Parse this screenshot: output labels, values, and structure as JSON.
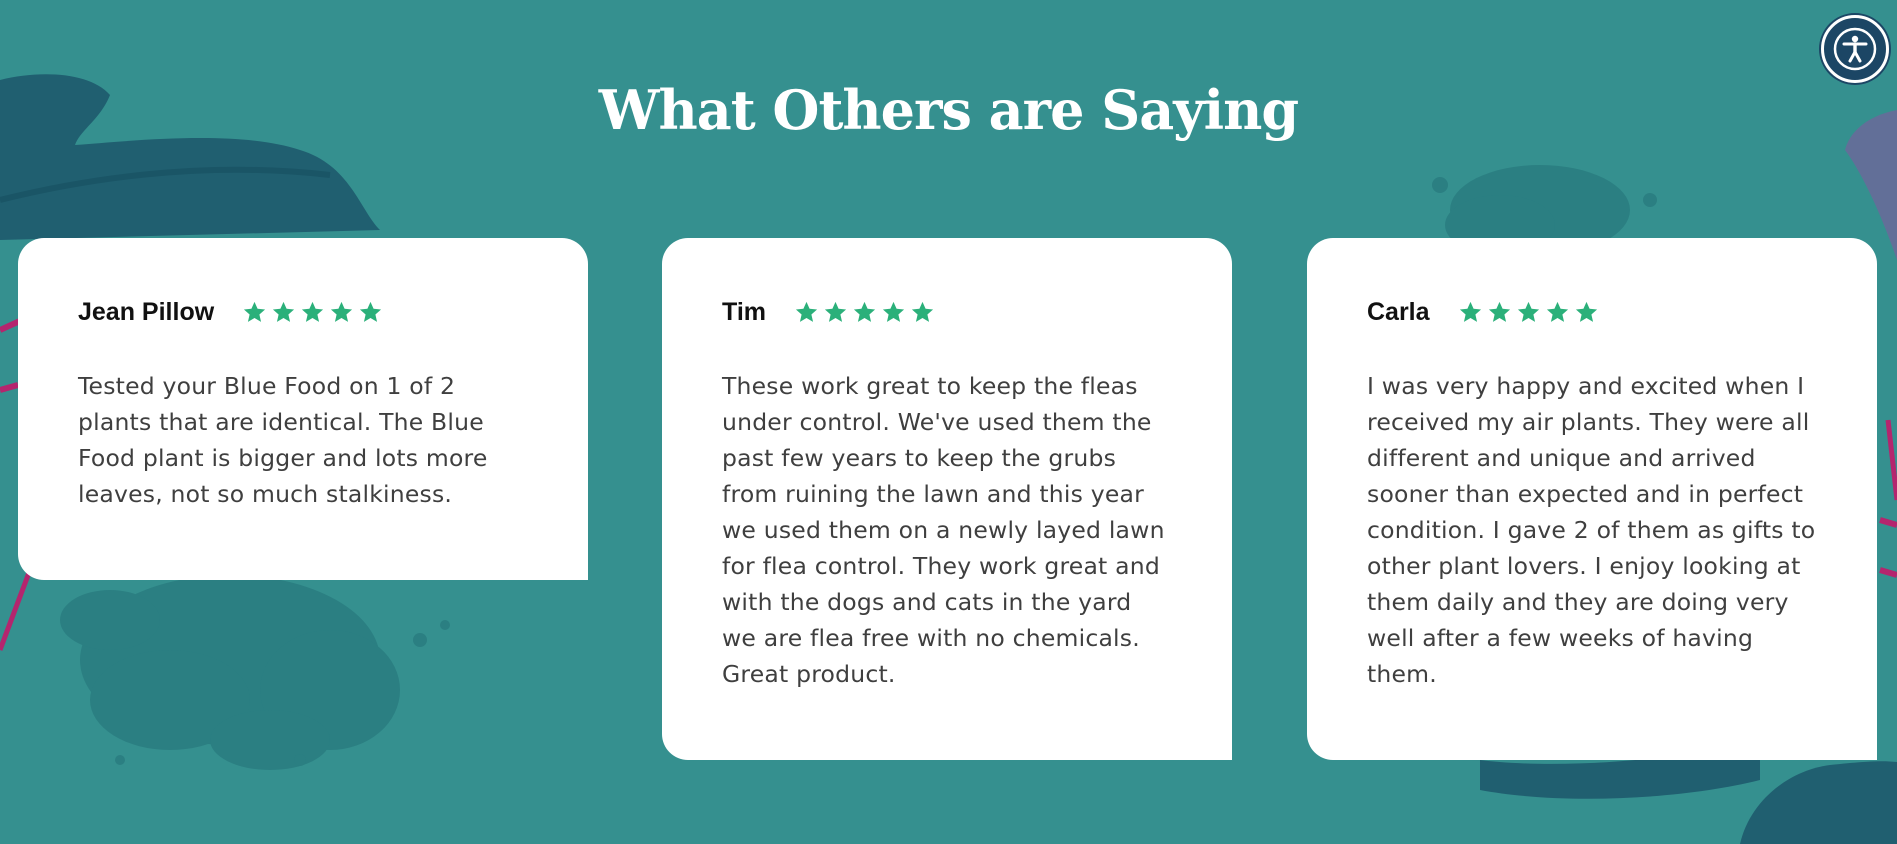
{
  "section": {
    "title": "What Others are Saying"
  },
  "colors": {
    "background": "#35908f",
    "card": "#ffffff",
    "star": "#2bb07a",
    "accessibility_button": "#1c4665"
  },
  "accessibility": {
    "icon": "accessibility-person-icon"
  },
  "reviews": [
    {
      "name": "Jean Pillow",
      "rating": 5,
      "text": "Tested your Blue Food on 1 of 2 plants that are identical. The Blue Food plant is bigger and lots more leaves, not so much stalkiness."
    },
    {
      "name": "Tim",
      "rating": 5,
      "text": "These work great to keep the fleas under control. We've used them the past few years to keep the grubs from ruining the lawn and this year we used them on a newly layed lawn for flea control. They work great and with the dogs and cats in the yard we are flea free with no chemicals. Great product."
    },
    {
      "name": "Carla",
      "rating": 5,
      "text": "I was very happy and excited when I received my air plants. They were all different and unique and arrived sooner than expected and in perfect condition. I gave 2 of them as gifts to other plant lovers. I enjoy looking at them daily and they are doing very well after a few weeks of having them."
    }
  ]
}
